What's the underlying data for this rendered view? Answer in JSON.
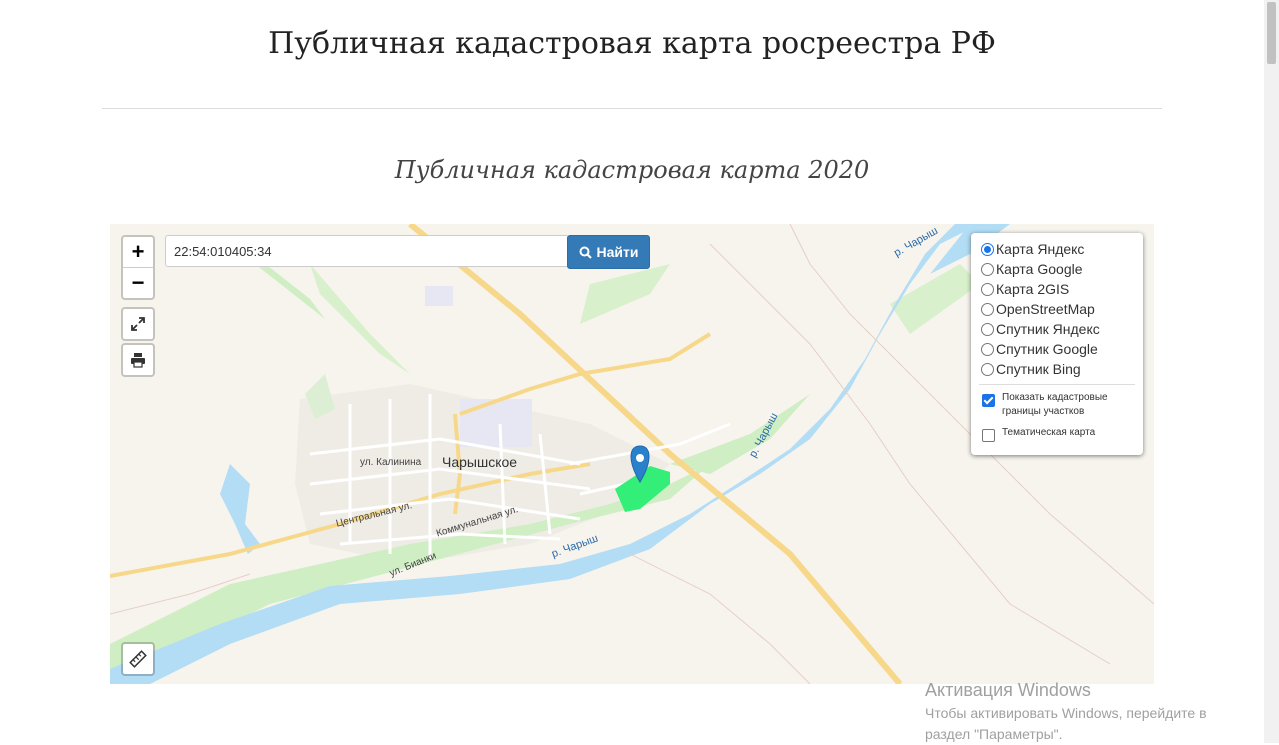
{
  "header": {
    "title": "Публичная кадастровая карта росреестра РФ",
    "subtitle": "Публичная кадастровая карта 2020"
  },
  "search": {
    "value": "22:54:010405:34",
    "button_label": "Найти",
    "button_icon": "search-icon"
  },
  "controls": {
    "zoom_in": "+",
    "zoom_out": "−",
    "fullscreen_icon": "fullscreen-icon",
    "print_icon": "print-icon",
    "ruler_icon": "ruler-icon"
  },
  "layers": {
    "options": [
      {
        "label": "Карта Яндекс",
        "checked": true
      },
      {
        "label": "Карта Google",
        "checked": false
      },
      {
        "label": "Карта 2GIS",
        "checked": false
      },
      {
        "label": "OpenStreetMap",
        "checked": false
      },
      {
        "label": "Спутник Яндекс",
        "checked": false
      },
      {
        "label": "Спутник Google",
        "checked": false
      },
      {
        "label": "Спутник Bing",
        "checked": false
      }
    ],
    "show_boundaries": {
      "label": "Показать кадастровые границы участков",
      "checked": true
    },
    "thematic": {
      "label": "Тематическая карта",
      "checked": false
    }
  },
  "map_labels": {
    "town": "Чарышское",
    "river_1": "р. Чарыш",
    "river_2": "р. Чарыш",
    "river_3": "р. Чарыш",
    "street_kalinina": "ул. Калинина",
    "street_central": "Центральная ул.",
    "street_communal": "Коммунальная ул.",
    "street_bianki": "ул. Бианки"
  },
  "colors": {
    "water": "#b3dcf5",
    "parcel": "#33ee77",
    "marker": "#2a81cb",
    "road": "#f7d88a",
    "button": "#337ab7"
  },
  "watermark": {
    "title": "Активация Windows",
    "line1": "Чтобы активировать Windows, перейдите в",
    "line2": "раздел \"Параметры\"."
  }
}
